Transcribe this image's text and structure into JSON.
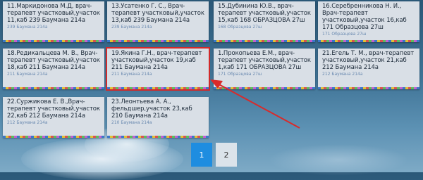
{
  "doctors": [
    {
      "title": "11.Маркидонова М.Д, врач-терапевт участковый,участок 11,каб 239 Баумана 214а",
      "address": "239 Баумана 214а"
    },
    {
      "title": "13.Усатенко Г. С., Врач-терапевт участковый,участок 13,каб 239 Баумана 214а",
      "address": "239 Баумана 214а"
    },
    {
      "title": "15.Дубинина Ю.В., врач-терапевт участковый,участок 15,каб 168 ОБРАЗЦОВА 27ш",
      "address": "168 Образцова 27ш"
    },
    {
      "title": "16.Серебренникова Н. И., Врач-терапевт участковый,участок 16,каб 171 Образцова 27ш",
      "address": "171 Образцова 27ш"
    },
    {
      "title": "18.Редикальцева М. В., Врач-терапевт участковый,участок 18,каб 211 Баумана 214а",
      "address": "211 Баумана 214а"
    },
    {
      "title": "19.Якина Г.Н., врач-терапевт участковый,участок 19,каб 211 Баумана 214а",
      "address": "211 Баумана 214а"
    },
    {
      "title": "1.Прокопьева Е.М., врач-терапевт участковый,участок 1,каб 171 ОБРАЗЦОВА 27ш",
      "address": "171 Образцова 27ш"
    },
    {
      "title": "21.Егель Т. М., врач-терапевт участковый,участок 21,каб 212 Баумана 214а",
      "address": "212 Баумана 214а"
    },
    {
      "title": "22.Суржикова Е. В.,Врач-терапевт участковый,участок 22,каб 212 Баумана 214а",
      "address": "212 Баумана 214а"
    },
    {
      "title": "23.Леонтьева А. А., фельдшер,участок 23,каб 210 Баумана 214а",
      "address": "210 Баумана 214а"
    }
  ],
  "pagination": {
    "pages": [
      "1",
      "2"
    ],
    "active": "1"
  }
}
